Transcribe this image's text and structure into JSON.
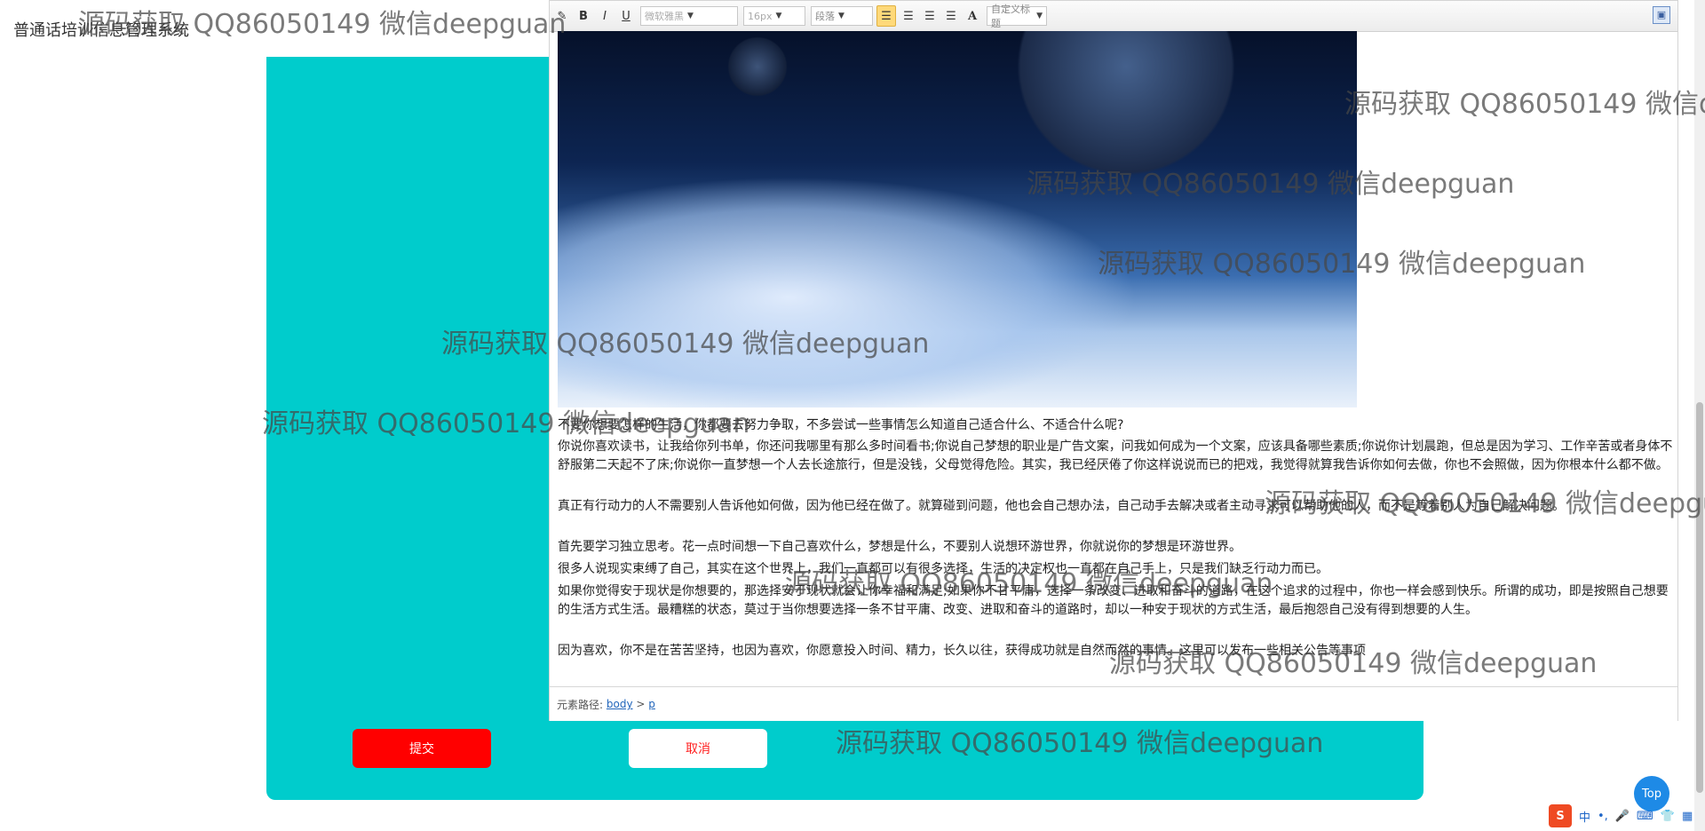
{
  "header": {
    "system_title": "普通话培训信息管理系统",
    "fullscreen_icon": "fullscreen-icon",
    "user_icon": "user-icon"
  },
  "toolbar": {
    "bold": "B",
    "italic": "I",
    "underline": "U",
    "font_placeholder": "微软雅黑",
    "size_placeholder": "16px",
    "paragraph_select": "段落",
    "font_color": "A",
    "custom_title_select": "自定义标题"
  },
  "content": {
    "paragraphs": [
      "不要你想要怎样的生活，你都要去努力争取，不多尝试一些事情怎么知道自己适合什么、不适合什么呢?",
      "你说你喜欢读书，让我给你列书单，你还问我哪里有那么多时间看书;你说自己梦想的职业是广告文案，问我如何成为一个文案，应该具备哪些素质;你说你计划晨跑，但总是因为学习、工作辛苦或者身体不舒服第二天起不了床;你说你一直梦想一个人去长途旅行，但是没钱，父母觉得危险。其实，我已经厌倦了你这样说说而已的把戏，我觉得就算我告诉你如何去做，你也不会照做，因为你根本什么都不做。",
      "真正有行动力的人不需要别人告诉他如何做，因为他已经在做了。就算碰到问题，他也会自己想办法，自己动手去解决或者主动寻求可以帮助他的人，而不是等着别人为自己解决问题。",
      "首先要学习独立思考。花一点时间想一下自己喜欢什么，梦想是什么，不要别人说想环游世界，你就说你的梦想是环游世界。",
      "很多人说现实束缚了自己，其实在这个世界上，我们一直都可以有很多选择，生活的决定权也一直都在自己手上，只是我们缺乏行动力而已。",
      "如果你觉得安于现状是你想要的，那选择安于现状就会让你幸福和满足;如果你不甘平庸，选择一条改变、进取和奋斗的道路，在这个追求的过程中，你也一样会感到快乐。所谓的成功，即是按照自己想要的生活方式生活。最糟糕的状态，莫过于当你想要选择一条不甘平庸、改变、进取和奋斗的道路时，却以一种安于现状的方式生活，最后抱怨自己没有得到想要的人生。",
      "因为喜欢，你不是在苦苦坚持，也因为喜欢，你愿意投入时间、精力，长久以往，获得成功就是自然而然的事情。这里可以发布一些相关公告等事项"
    ]
  },
  "status_bar": {
    "label": "元素路径:",
    "path_body": "body",
    "separator": ">",
    "path_p": "p"
  },
  "buttons": {
    "submit": "提交",
    "cancel": "取消",
    "top": "Top"
  },
  "ime": {
    "logo": "S",
    "lang": "中",
    "punct": "•,"
  },
  "watermark": {
    "text": "源码获取 QQ86050149 微信deepguan"
  },
  "colors": {
    "panel_teal": "#00cccc",
    "submit_red": "#ff0000",
    "accent_blue": "#1e8ae6"
  }
}
